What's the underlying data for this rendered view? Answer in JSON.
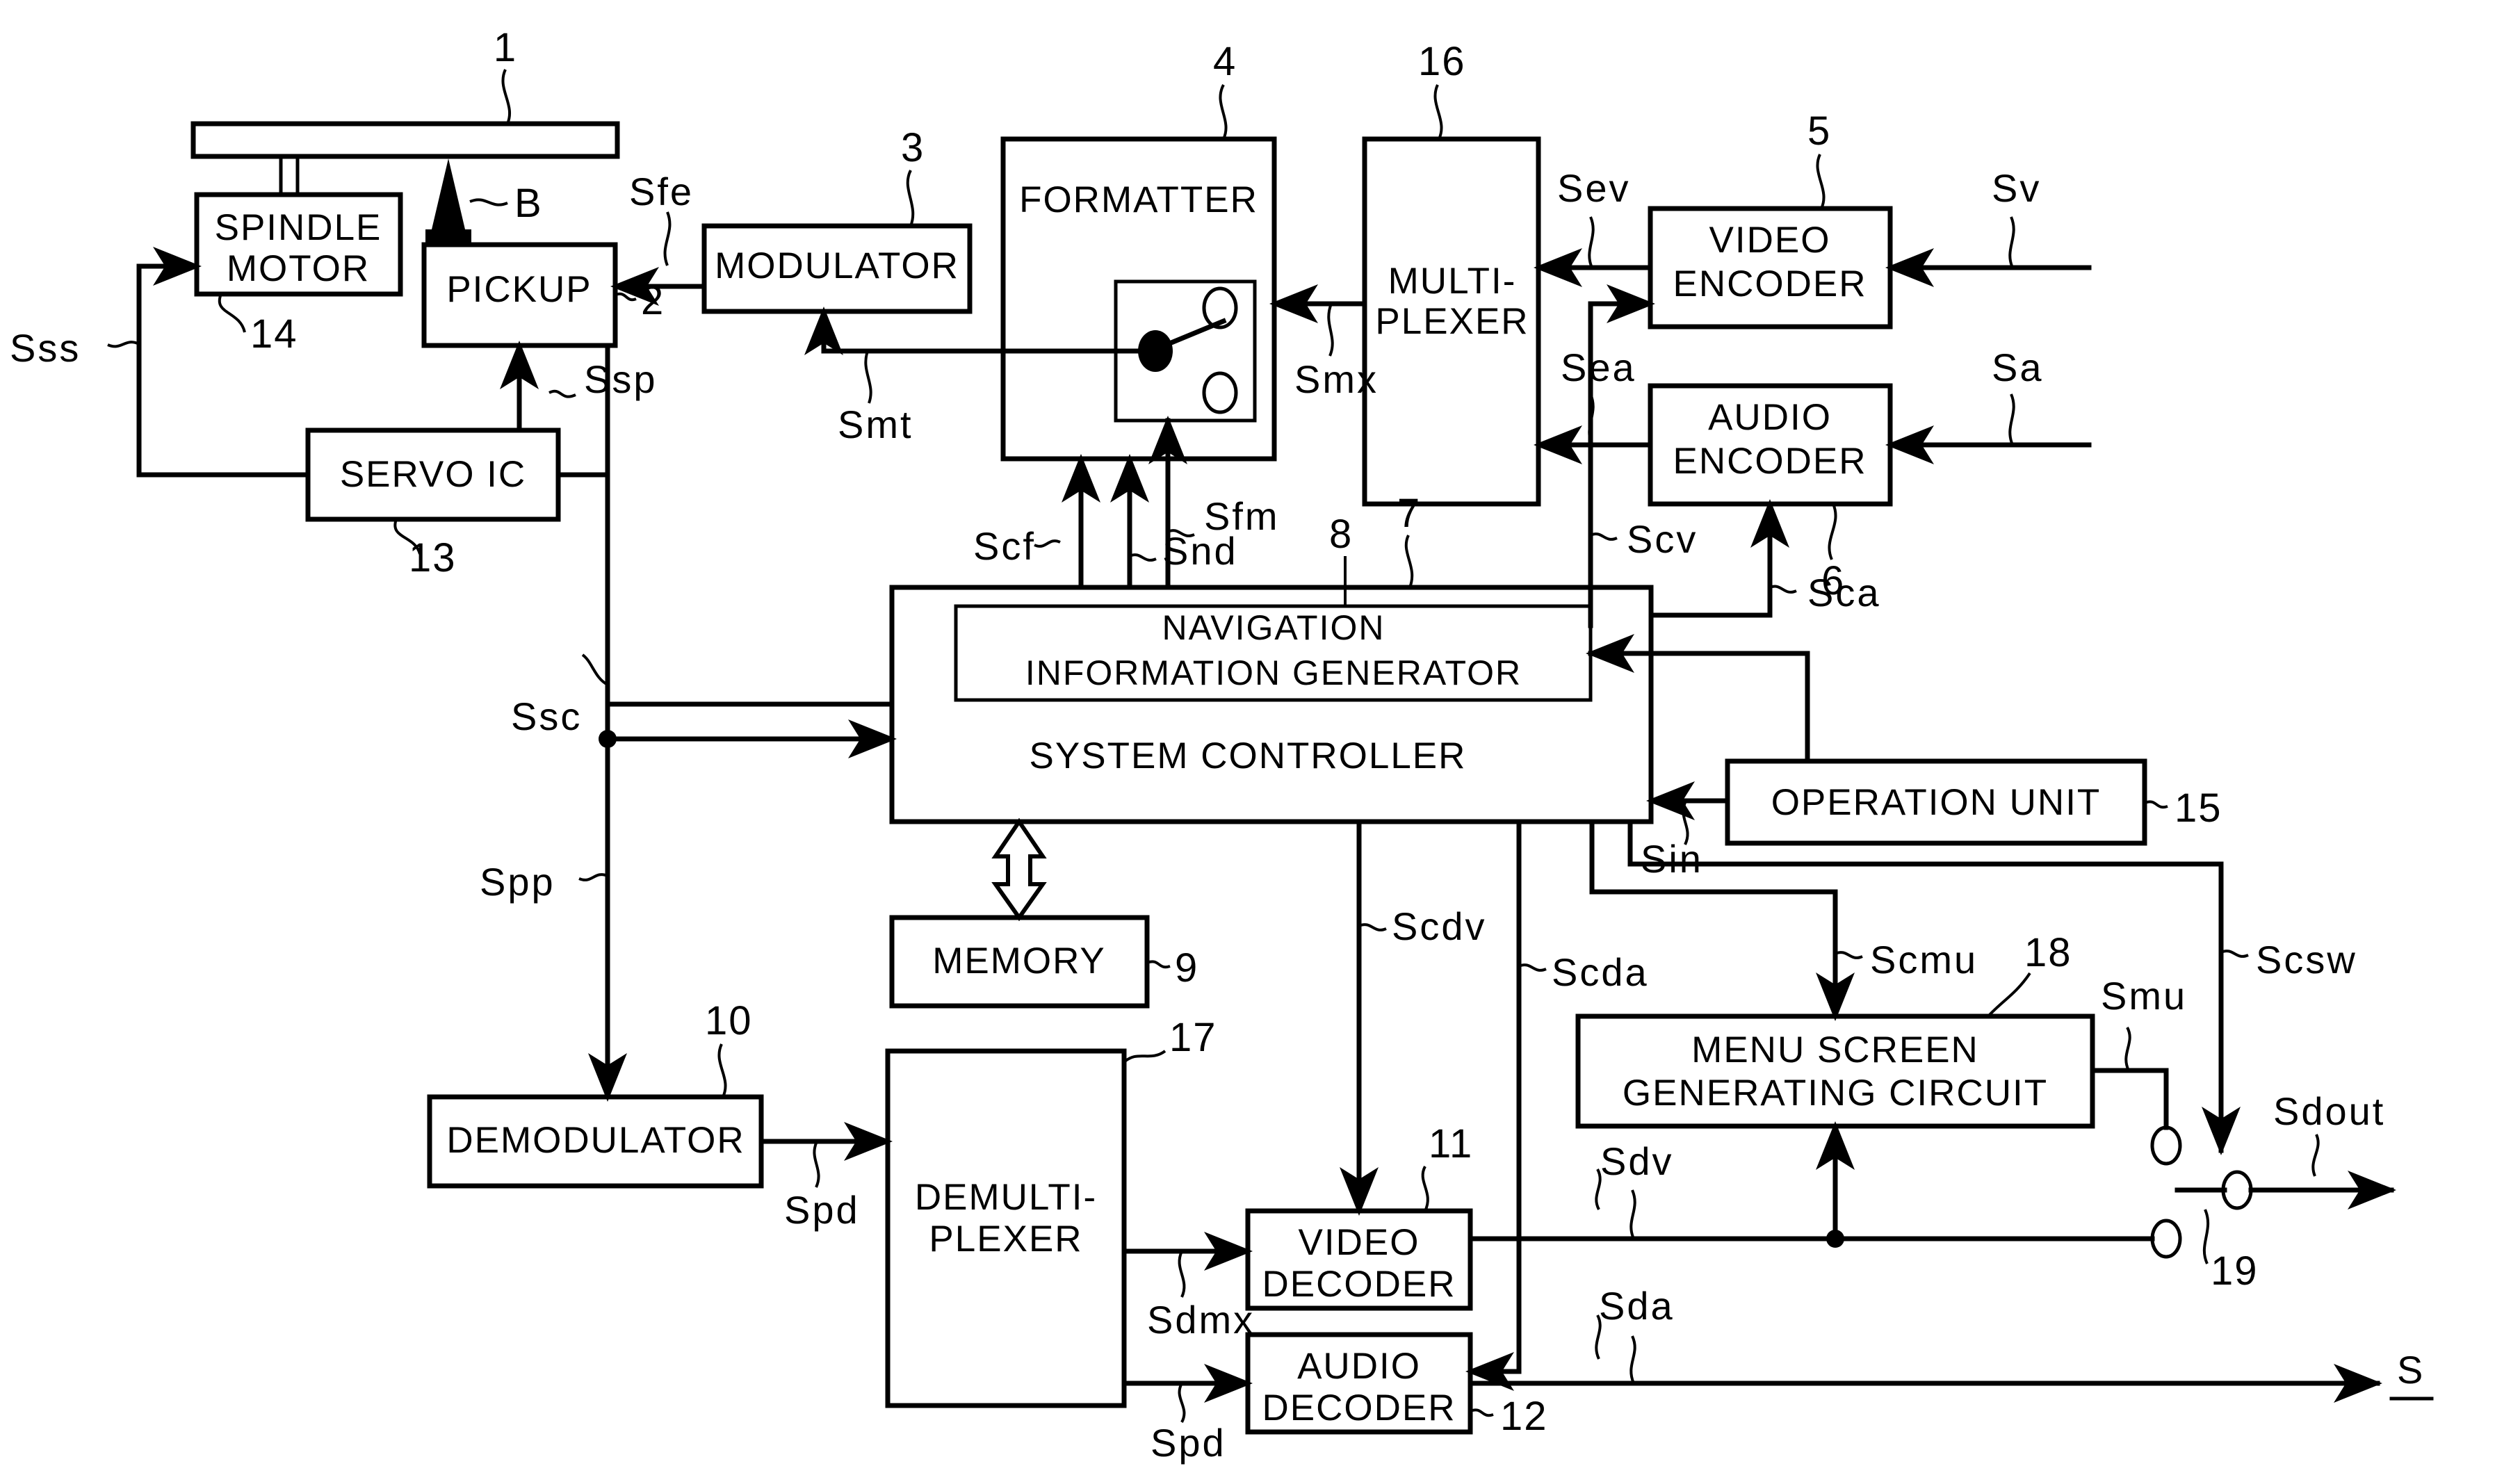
{
  "figure": {
    "type": "block-diagram",
    "description": "Optical disc recorder/player block diagram with navigation information generator"
  },
  "blocks": [
    {
      "id": "disc",
      "label": "",
      "ref": "1"
    },
    {
      "id": "spindle",
      "label": "SPINDLE\nMOTOR",
      "ref": "14"
    },
    {
      "id": "pickup",
      "label": "PICKUP",
      "ref": "2"
    },
    {
      "id": "servo",
      "label": "SERVO IC",
      "ref": "13"
    },
    {
      "id": "modulator",
      "label": "MODULATOR",
      "ref": "3"
    },
    {
      "id": "formatter",
      "label": "FORMATTER",
      "ref": "4"
    },
    {
      "id": "mux",
      "label": "MULTI-\nPLEXER",
      "ref": "16"
    },
    {
      "id": "vencoder",
      "label": "VIDEO\nENCODER",
      "ref": "5"
    },
    {
      "id": "aencoder",
      "label": "AUDIO\nENCODER",
      "ref": "6"
    },
    {
      "id": "navgen",
      "label": "NAVIGATION\nINFORMATION GENERATOR",
      "ref": "8"
    },
    {
      "id": "syscon",
      "label": "SYSTEM CONTROLLER",
      "ref": "7"
    },
    {
      "id": "memory",
      "label": "MEMORY",
      "ref": "9"
    },
    {
      "id": "opunit",
      "label": "OPERATION UNIT",
      "ref": "15"
    },
    {
      "id": "demod",
      "label": "DEMODULATOR",
      "ref": "10"
    },
    {
      "id": "demux",
      "label": "DEMULTI-\nPLEXER",
      "ref": "17"
    },
    {
      "id": "vdecoder",
      "label": "VIDEO\nDECODER",
      "ref": "11"
    },
    {
      "id": "adecoder",
      "label": "AUDIO\nDECODER",
      "ref": "12"
    },
    {
      "id": "menugen",
      "label": "MENU SCREEN\nGENERATING CIRCUIT",
      "ref": "18"
    },
    {
      "id": "switch",
      "label": "",
      "ref": "19"
    }
  ],
  "block_labels": {
    "spindle_l1": "SPINDLE",
    "spindle_l2": "MOTOR",
    "pickup": "PICKUP",
    "servo": "SERVO IC",
    "modulator": "MODULATOR",
    "formatter": "FORMATTER",
    "mux_l1": "MULTI-",
    "mux_l2": "PLEXER",
    "vencoder_l1": "VIDEO",
    "vencoder_l2": "ENCODER",
    "aencoder_l1": "AUDIO",
    "aencoder_l2": "ENCODER",
    "navgen_l1": "NAVIGATION",
    "navgen_l2": "INFORMATION GENERATOR",
    "syscon": "SYSTEM CONTROLLER",
    "memory": "MEMORY",
    "opunit": "OPERATION UNIT",
    "demod": "DEMODULATOR",
    "demux_l1": "DEMULTI-",
    "demux_l2": "PLEXER",
    "vdecoder_l1": "VIDEO",
    "vdecoder_l2": "DECODER",
    "adecoder_l1": "AUDIO",
    "adecoder_l2": "DECODER",
    "menugen_l1": "MENU SCREEN",
    "menugen_l2": "GENERATING CIRCUIT"
  },
  "reference_numerals": {
    "disc": "1",
    "pickup": "2",
    "modulator": "3",
    "formatter": "4",
    "vencoder": "5",
    "aencoder": "6",
    "syscon": "7",
    "navgen": "8",
    "memory": "9",
    "demod": "10",
    "vdecoder": "11",
    "adecoder": "12",
    "servo": "13",
    "spindle": "14",
    "opunit": "15",
    "mux": "16",
    "demux": "17",
    "menugen": "18",
    "switch": "19",
    "beam": "B"
  },
  "signals": [
    {
      "name": "Sss",
      "description": "spindle servo signal"
    },
    {
      "name": "Ssp",
      "description": "pickup servo signal"
    },
    {
      "name": "Ssc",
      "description": "servo control signal"
    },
    {
      "name": "Spp",
      "description": "pickup playback signal"
    },
    {
      "name": "Sfe",
      "description": "formatter encoded signal to pickup"
    },
    {
      "name": "Smt",
      "description": "modulator input signal"
    },
    {
      "name": "Smx",
      "description": "multiplexed signal"
    },
    {
      "name": "Sev",
      "description": "encoded video signal"
    },
    {
      "name": "Sea",
      "description": "encoded audio signal"
    },
    {
      "name": "Sv",
      "description": "video input"
    },
    {
      "name": "Sa",
      "description": "audio input"
    },
    {
      "name": "Scv",
      "description": "video encoder control"
    },
    {
      "name": "Sca",
      "description": "audio encoder control"
    },
    {
      "name": "Scf",
      "description": "formatter control"
    },
    {
      "name": "Sfm",
      "description": "formatter switch control"
    },
    {
      "name": "Snd",
      "description": "navigation data"
    },
    {
      "name": "Sin",
      "description": "operation input"
    },
    {
      "name": "Scdv",
      "description": "video decoder control"
    },
    {
      "name": "Scda",
      "description": "audio decoder control"
    },
    {
      "name": "Scmu",
      "description": "menu generator control"
    },
    {
      "name": "Scsw",
      "description": "switch control"
    },
    {
      "name": "Spd",
      "description": "playback demodulated data"
    },
    {
      "name": "Sdmx",
      "description": "demultiplexed video stream"
    },
    {
      "name": "Sdv",
      "description": "decoded video"
    },
    {
      "name": "Sda",
      "description": "decoded audio"
    },
    {
      "name": "Smu",
      "description": "menu video signal"
    },
    {
      "name": "Sdout",
      "description": "video output"
    },
    {
      "name": "S",
      "description": "audio output"
    }
  ],
  "signal_labels": {
    "Sss": "Sss",
    "Ssp": "Ssp",
    "Ssc": "Ssc",
    "Spp": "Spp",
    "Sfe": "Sfe",
    "Smt": "Smt",
    "Smx": "Smx",
    "Sev": "Sev",
    "Sea": "Sea",
    "Sv": "Sv",
    "Sa": "Sa",
    "Scv": "Scv",
    "Sca": "Sca",
    "Scf": "Scf",
    "Sfm": "Sfm",
    "Snd": "Snd",
    "Sin": "Sin",
    "Scdv": "Scdv",
    "Scda": "Scda",
    "Scmu": "Scmu",
    "Scsw": "Scsw",
    "Spd1": "Spd",
    "Spd2": "Spd",
    "Sdmx": "Sdmx",
    "Sdv1": "Sdv",
    "Sdv2": "Sdv",
    "Sda1": "Sda",
    "Sda2": "Sda",
    "Smu": "Smu",
    "Sdout": "Sdout",
    "Sout": "S"
  }
}
